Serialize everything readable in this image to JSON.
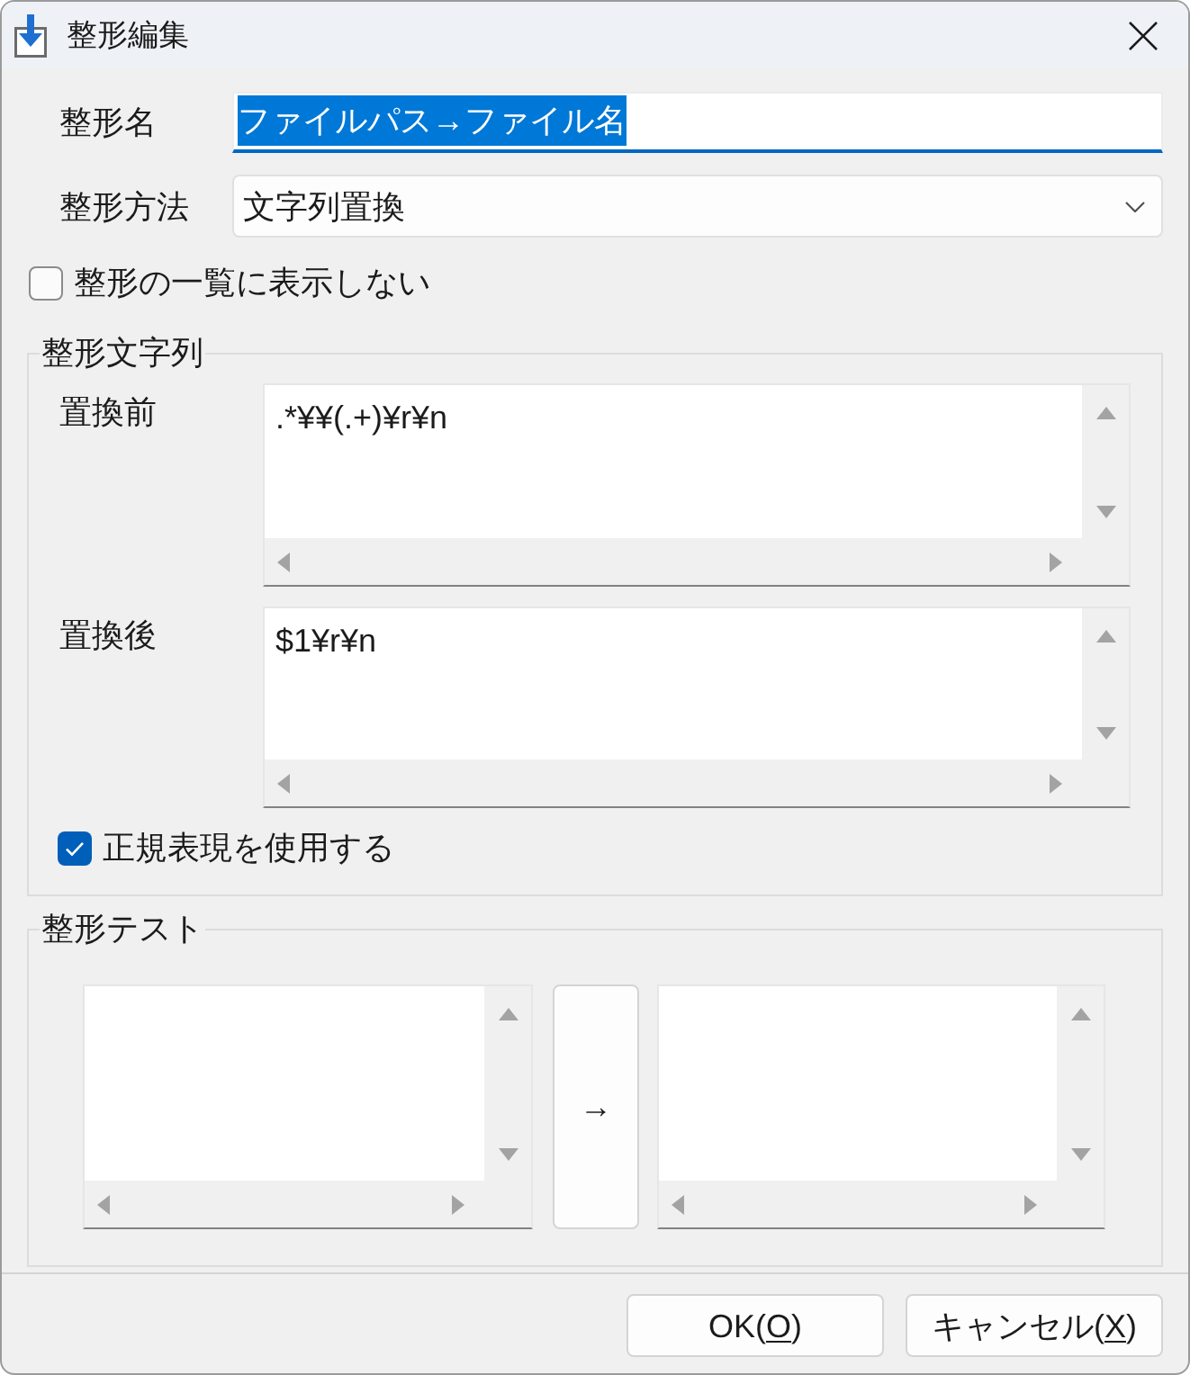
{
  "window": {
    "title": "整形編集"
  },
  "form_rows": [
    {
      "kind": "text",
      "label": "整形名",
      "value": "ファイルパス→ファイル名",
      "focused": true,
      "text_selected": true
    },
    {
      "kind": "dropdown",
      "label": "整形方法",
      "value": "文字列置換"
    }
  ],
  "hide_from_list": {
    "label": "整形の一覧に表示しない",
    "checked": false
  },
  "pattern_group": {
    "title": "整形文字列",
    "fields": [
      {
        "label": "置換前",
        "value": ".*¥¥(.+)¥r¥n"
      },
      {
        "label": "置換後",
        "value": "$1¥r¥n"
      }
    ],
    "use_regex": {
      "label": "正規表現を使用する",
      "checked": true
    }
  },
  "test_group": {
    "title": "整形テスト",
    "run_button": "→"
  },
  "buttons": [
    {
      "label": "OK(",
      "access_key": "O",
      "label_end": ")"
    },
    {
      "label": "キャンセル(",
      "access_key": "X",
      "label_end": ")"
    }
  ]
}
